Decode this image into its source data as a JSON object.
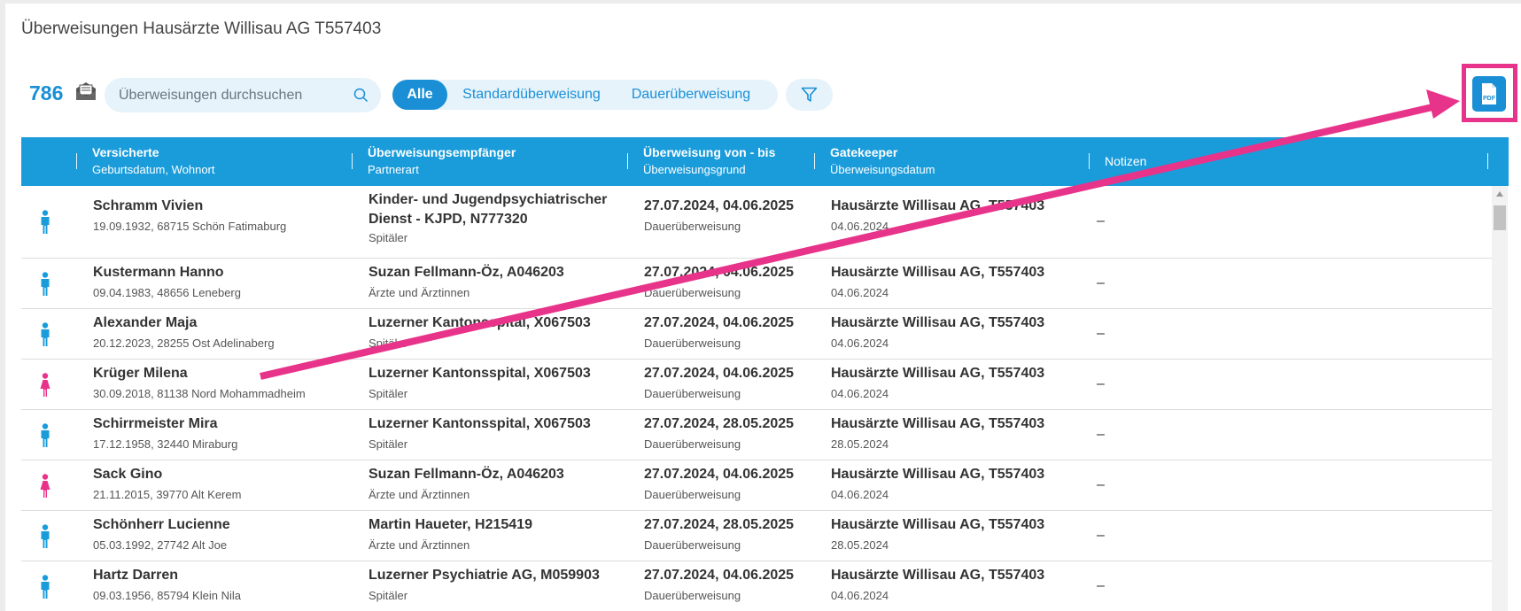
{
  "page": {
    "title": "Überweisungen Hausärzte Willisau AG T557403"
  },
  "toolbar": {
    "count": "786",
    "search_placeholder": "Überweisungen durchsuchen",
    "segments": [
      "Alle",
      "Standardüberweisung",
      "Dauerüberweisung"
    ],
    "active_segment": "Alle",
    "filter_icon": "filter-icon",
    "pdf_icon": "pdf-icon",
    "envelope_icon": "envelope-icon"
  },
  "table": {
    "headers": [
      {
        "title": "Versicherte",
        "subtitle": "Geburtsdatum, Wohnort"
      },
      {
        "title": "Überweisungsempfänger",
        "subtitle": "Partnerart"
      },
      {
        "title": "Überweisung von - bis",
        "subtitle": "Überweisungsgrund"
      },
      {
        "title": "Gatekeeper",
        "subtitle": "Überweisungsdatum"
      },
      {
        "title": "Notizen",
        "subtitle": ""
      }
    ],
    "rows": [
      {
        "gender": "male",
        "name": "Schramm Vivien",
        "details": "19.09.1932, 68715 Schön Fatimaburg",
        "recipient": "Kinder- und Jugendpsychiatrischer Dienst - KJPD, N777320",
        "partner_type": "Spitäler",
        "period": "27.07.2024, 04.06.2025",
        "reason": "Dauerüberweisung",
        "gatekeeper": "Hausärzte Willisau AG, T557403",
        "date": "04.06.2024",
        "notes": "–"
      },
      {
        "gender": "male",
        "name": "Kustermann Hanno",
        "details": "09.04.1983, 48656 Leneberg",
        "recipient": "Suzan Fellmann-Öz, A046203",
        "partner_type": "Ärzte und Ärztinnen",
        "period": "27.07.2024, 04.06.2025",
        "reason": "Dauerüberweisung",
        "gatekeeper": "Hausärzte Willisau AG, T557403",
        "date": "04.06.2024",
        "notes": "–"
      },
      {
        "gender": "male",
        "name": "Alexander Maja",
        "details": "20.12.2023, 28255 Ost Adelinaberg",
        "recipient": "Luzerner Kantonsspital, X067503",
        "partner_type": "Spitäler",
        "period": "27.07.2024, 04.06.2025",
        "reason": "Dauerüberweisung",
        "gatekeeper": "Hausärzte Willisau AG, T557403",
        "date": "04.06.2024",
        "notes": "–"
      },
      {
        "gender": "female",
        "name": "Krüger Milena",
        "details": "30.09.2018, 81138 Nord Mohammadheim",
        "recipient": "Luzerner Kantonsspital, X067503",
        "partner_type": "Spitäler",
        "period": "27.07.2024, 04.06.2025",
        "reason": "Dauerüberweisung",
        "gatekeeper": "Hausärzte Willisau AG, T557403",
        "date": "04.06.2024",
        "notes": "–"
      },
      {
        "gender": "male",
        "name": "Schirrmeister Mira",
        "details": "17.12.1958, 32440 Miraburg",
        "recipient": "Luzerner Kantonsspital, X067503",
        "partner_type": "Spitäler",
        "period": "27.07.2024, 28.05.2025",
        "reason": "Dauerüberweisung",
        "gatekeeper": "Hausärzte Willisau AG, T557403",
        "date": "28.05.2024",
        "notes": "–"
      },
      {
        "gender": "female",
        "name": "Sack Gino",
        "details": "21.11.2015, 39770 Alt Kerem",
        "recipient": "Suzan Fellmann-Öz, A046203",
        "partner_type": "Ärzte und Ärztinnen",
        "period": "27.07.2024, 04.06.2025",
        "reason": "Dauerüberweisung",
        "gatekeeper": "Hausärzte Willisau AG, T557403",
        "date": "04.06.2024",
        "notes": "–"
      },
      {
        "gender": "male",
        "name": "Schönherr Lucienne",
        "details": "05.03.1992, 27742 Alt Joe",
        "recipient": "Martin Haueter, H215419",
        "partner_type": "Ärzte und Ärztinnen",
        "period": "27.07.2024, 28.05.2025",
        "reason": "Dauerüberweisung",
        "gatekeeper": "Hausärzte Willisau AG, T557403",
        "date": "28.05.2024",
        "notes": "–"
      },
      {
        "gender": "male",
        "name": "Hartz Darren",
        "details": "09.03.1956, 85794 Klein Nila",
        "recipient": "Luzerner Psychiatrie AG, M059903",
        "partner_type": "Spitäler",
        "period": "27.07.2024, 04.06.2025",
        "reason": "Dauerüberweisung",
        "gatekeeper": "Hausärzte Willisau AG, T557403",
        "date": "04.06.2024",
        "notes": "–"
      }
    ]
  },
  "colors": {
    "accent": "#1a9cdb",
    "male": "#1a9cdb",
    "female": "#e8338a",
    "annotation": "#e8338a"
  }
}
